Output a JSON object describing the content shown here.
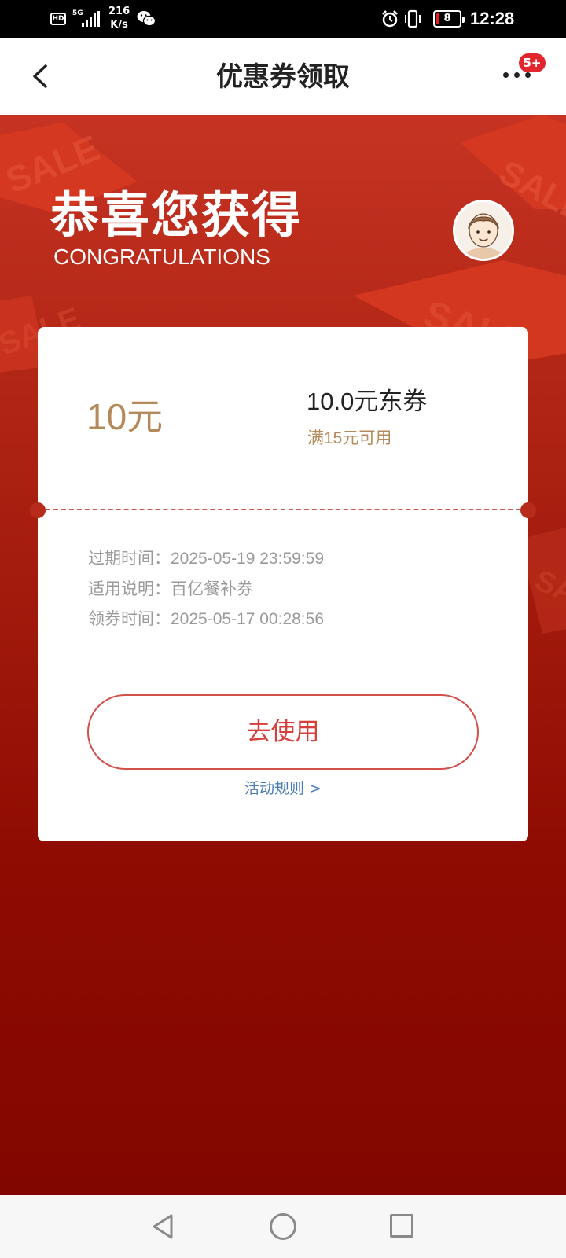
{
  "status_bar": {
    "hd": "HD",
    "network": "5G",
    "speed_value": "216",
    "speed_unit": "K/s",
    "battery": "8",
    "time": "12:28",
    "icons": [
      "hd-icon",
      "signal-icon",
      "wechat-icon",
      "alarm-icon",
      "vibrate-icon",
      "battery-icon"
    ]
  },
  "nav": {
    "title": "优惠券领取",
    "badge": "5+"
  },
  "hero": {
    "title": "恭喜您获得",
    "subtitle": "CONGRATULATIONS",
    "background_text": "SALE"
  },
  "coupon": {
    "amount": "10元",
    "name": "10.0元东券",
    "condition": "满15元可用",
    "details": [
      {
        "label": "过期时间：",
        "value": "2025-05-19 23:59:59"
      },
      {
        "label": "适用说明：",
        "value": "百亿餐补券"
      },
      {
        "label": "领券时间：",
        "value": "2025-05-17 00:28:56"
      }
    ],
    "use_button": "去使用",
    "rules_link": "活动规则 >"
  },
  "colors": {
    "accent_red": "#d4403b",
    "gold": "#b48a5a",
    "link_blue": "#4b7cb5",
    "badge_red": "#e2262e"
  }
}
